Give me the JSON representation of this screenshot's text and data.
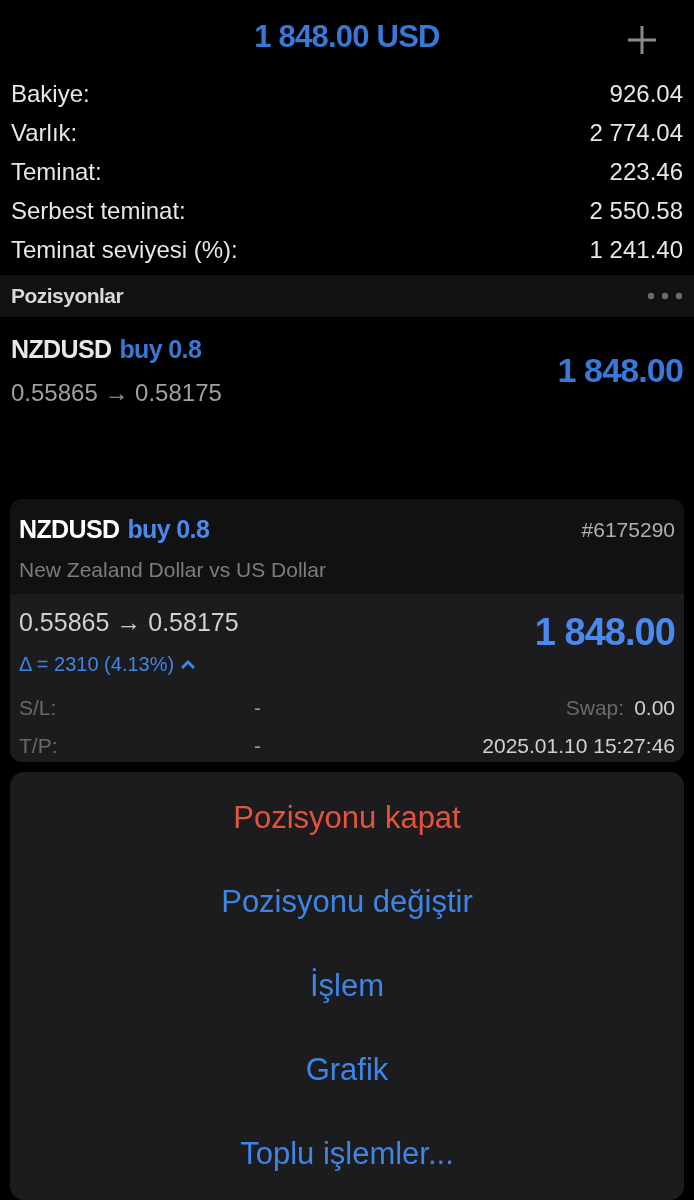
{
  "header": {
    "title": "1 848.00 USD"
  },
  "summary": [
    {
      "label": "Bakiye:",
      "value": "926.04"
    },
    {
      "label": "Varlık:",
      "value": "2 774.04"
    },
    {
      "label": "Teminat:",
      "value": "223.46"
    },
    {
      "label": "Serbest teminat:",
      "value": "2 550.58"
    },
    {
      "label": "Teminat seviyesi (%):",
      "value": "1 241.40"
    }
  ],
  "section": {
    "title": "Pozisyonlar"
  },
  "position": {
    "symbol": "NZDUSD",
    "side": "buy 0.8",
    "prices": "0.55865 → 0.58175",
    "profit": "1 848.00"
  },
  "detail": {
    "symbol": "NZDUSD",
    "side": "buy 0.8",
    "ticket": "#6175290",
    "description": "New Zealand Dollar vs US Dollar",
    "prices": "0.55865 → 0.58175",
    "profit": "1 848.00",
    "delta": "Δ = 2310 (4.13%)",
    "expanded": true,
    "fields": [
      {
        "label": "S/L:",
        "value": "-",
        "right_label": "Swap:",
        "right_value": "0.00"
      },
      {
        "label": "T/P:",
        "value": "-",
        "right_value": "2025.01.10 15:27:46"
      }
    ]
  },
  "actions": [
    {
      "label": "Pozisyonu kapat",
      "kind": "destructive"
    },
    {
      "label": "Pozisyonu değiştir",
      "kind": "default"
    },
    {
      "label": "İşlem",
      "kind": "default"
    },
    {
      "label": "Grafik",
      "kind": "default"
    },
    {
      "label": "Toplu işlemler...",
      "kind": "default"
    }
  ]
}
